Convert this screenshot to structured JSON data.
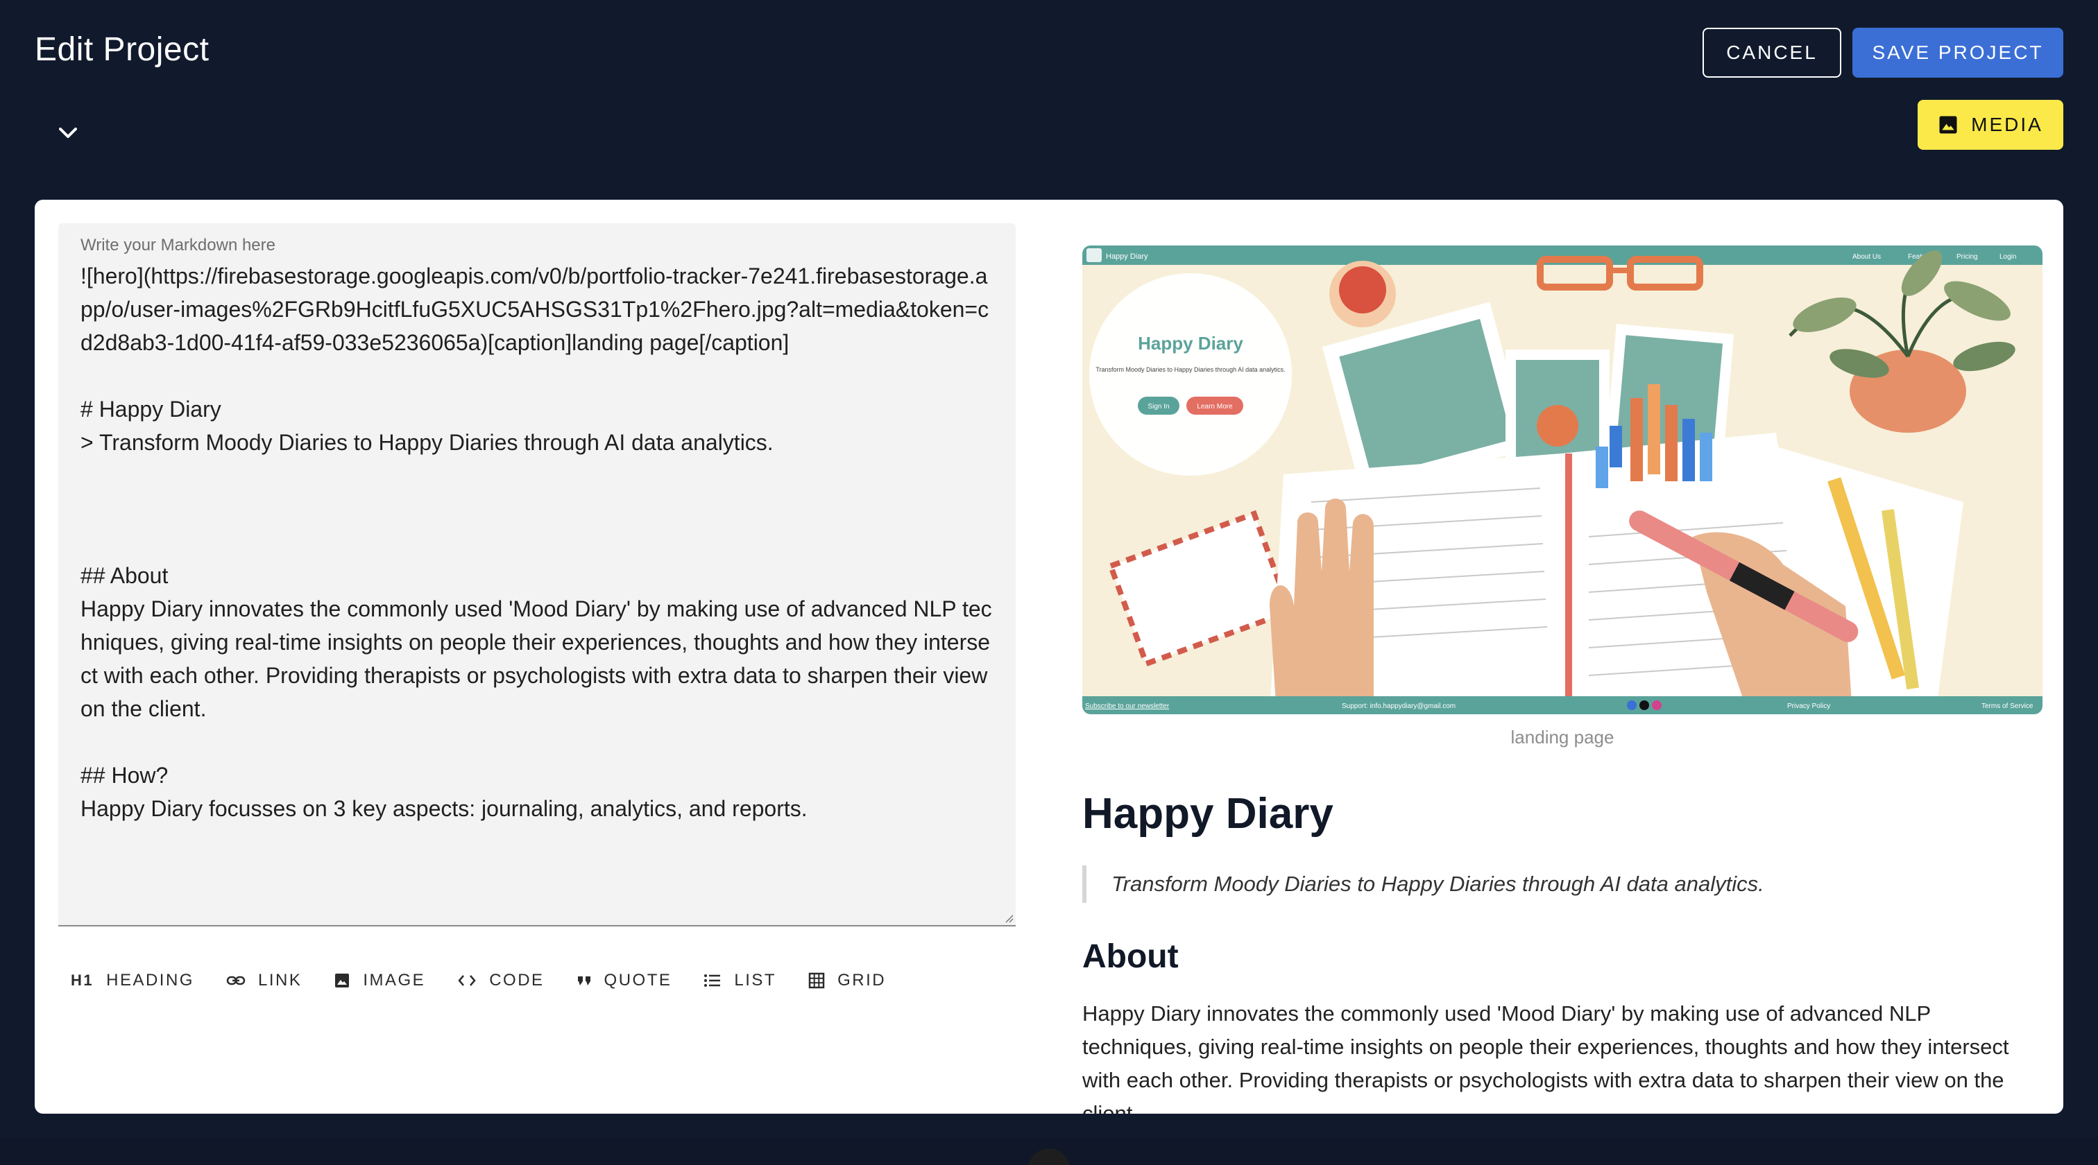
{
  "header": {
    "title": "Edit Project",
    "cancel_label": "CANCEL",
    "save_label": "SAVE PROJECT",
    "media_label": "MEDIA"
  },
  "editor": {
    "label": "Write your Markdown here",
    "content": "![hero](https://firebasestorage.googleapis.com/v0/b/portfolio-tracker-7e241.firebasestorage.app/o/user-images%2FGRb9HcitfLfuG5XUC5AHSGS31Tp1%2Fhero.jpg?alt=media&token=cd2d8ab3-1d00-41f4-af59-033e5236065a)[caption]landing page[/caption]\n\n# Happy Diary\n> Transform Moody Diaries to Happy Diaries through AI data analytics.\n\n\n\n## About\nHappy Diary innovates the commonly used 'Mood Diary' by making use of advanced NLP techniques, giving real-time insights on people their experiences, thoughts and how they intersect with each other. Providing therapists or psychologists with extra data to sharpen their view on the client.\n\n## How?\nHappy Diary focusses on 3 key aspects: journaling, analytics, and reports."
  },
  "toolbar": {
    "heading_icon": "H1",
    "heading": "HEADING",
    "link": "LINK",
    "image": "IMAGE",
    "code": "CODE",
    "quote": "QUOTE",
    "list": "LIST",
    "grid": "GRID"
  },
  "hero": {
    "nav_brand": "Happy Diary",
    "nav_links": [
      "About Us",
      "Features",
      "Pricing",
      "Login"
    ],
    "card_title": "Happy Diary",
    "card_text": "Transform Moody Diaries to Happy Diaries through AI data analytics.",
    "sign_in": "Sign In",
    "learn_more": "Learn More",
    "footer_newsletter": "Subscribe to our newsletter",
    "footer_support": "Support: info.happydiary@gmail.com",
    "footer_privacy": "Privacy Policy",
    "footer_terms": "Terms of Service"
  },
  "preview": {
    "caption": "landing page",
    "title": "Happy Diary",
    "quote": "Transform Moody Diaries to Happy Diaries through AI data analytics.",
    "about_heading": "About",
    "about_text": "Happy Diary innovates the commonly used 'Mood Diary' by making use of advanced NLP techniques, giving real-time insights on people their experiences, thoughts and how they intersect with each other. Providing therapists or psychologists with extra data to sharpen their view on the client."
  },
  "colors": {
    "background": "#111a2d",
    "save_button": "#3b6fd6",
    "media_button": "#fbe94a",
    "hero_bar": "#5aa39a",
    "hero_bg": "#f7efd9"
  }
}
